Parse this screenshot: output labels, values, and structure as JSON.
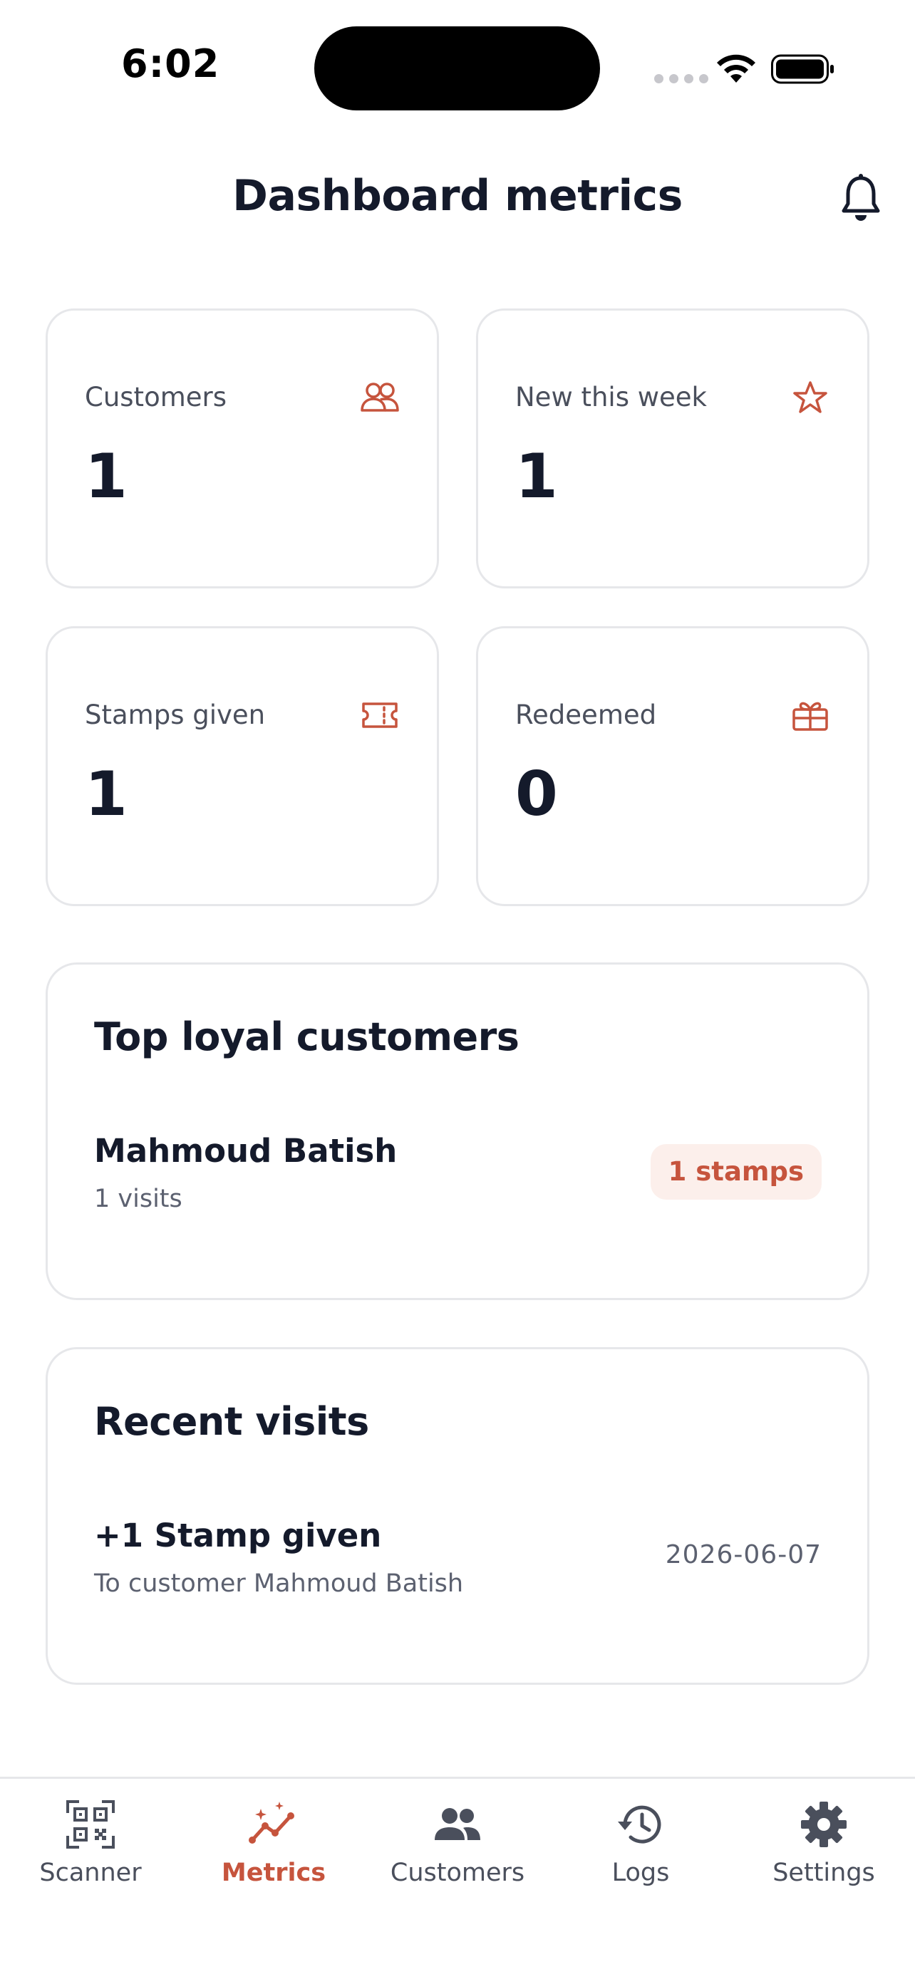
{
  "status_bar": {
    "time": "6:02"
  },
  "header": {
    "title": "Dashboard metrics"
  },
  "metrics": [
    {
      "label": "Customers",
      "value": "1",
      "icon": "users-icon"
    },
    {
      "label": "New this week",
      "value": "1",
      "icon": "star-icon"
    },
    {
      "label": "Stamps given",
      "value": "1",
      "icon": "ticket-icon"
    },
    {
      "label": "Redeemed",
      "value": "0",
      "icon": "gift-icon"
    }
  ],
  "top_loyal": {
    "title": "Top loyal customers",
    "rows": [
      {
        "name": "Mahmoud Batish",
        "visits": "1 visits",
        "stamps": "1 stamps"
      }
    ]
  },
  "recent_visits": {
    "title": "Recent visits",
    "rows": [
      {
        "title": "+1 Stamp given",
        "subtitle": "To customer Mahmoud Batish",
        "date": "2026-06-07"
      }
    ]
  },
  "tabs": [
    {
      "label": "Scanner",
      "icon": "qr-scanner-icon",
      "active": false
    },
    {
      "label": "Metrics",
      "icon": "chart-line-icon",
      "active": true
    },
    {
      "label": "Customers",
      "icon": "people-icon",
      "active": false
    },
    {
      "label": "Logs",
      "icon": "history-icon",
      "active": false
    },
    {
      "label": "Settings",
      "icon": "gear-icon",
      "active": false
    }
  ],
  "colors": {
    "accent": "#c6543d",
    "accent_soft": "#fcefeb",
    "text_primary": "#141a2b",
    "text_secondary": "#5c6170",
    "border": "#e6e7ea",
    "tab_inactive": "#4a4f5c"
  }
}
